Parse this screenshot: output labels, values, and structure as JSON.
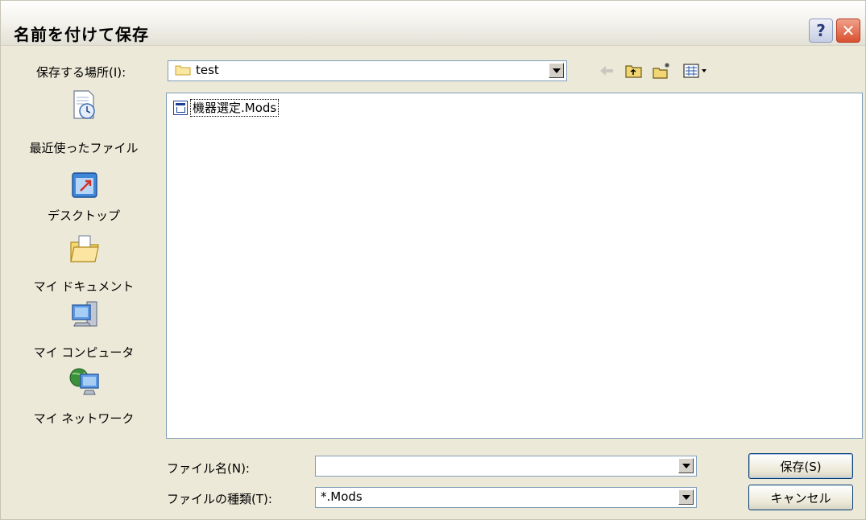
{
  "window": {
    "title": "名前を付けて保存"
  },
  "titlebar": {
    "help_label": "?",
    "close_label": "✕"
  },
  "location": {
    "label": "保存する場所(I):",
    "value": "test"
  },
  "places": [
    {
      "label": "最近使ったファイル",
      "icon": "recent-files-icon"
    },
    {
      "label": "デスクトップ",
      "icon": "desktop-icon"
    },
    {
      "label": "マイ ドキュメント",
      "icon": "my-documents-icon"
    },
    {
      "label": "マイ コンピュータ",
      "icon": "my-computer-icon"
    },
    {
      "label": "マイ ネットワーク",
      "icon": "my-network-icon"
    }
  ],
  "files": [
    {
      "name": "機器選定.Mods"
    }
  ],
  "filename": {
    "label": "ファイル名(N):",
    "value": ""
  },
  "filetype": {
    "label": "ファイルの種類(T):",
    "value": "*.Mods"
  },
  "buttons": {
    "save": "保存(S)",
    "cancel": "キャンセル"
  },
  "colors": {
    "accent": "#7f9db9",
    "face": "#ece9d8",
    "close": "#d9502f"
  }
}
